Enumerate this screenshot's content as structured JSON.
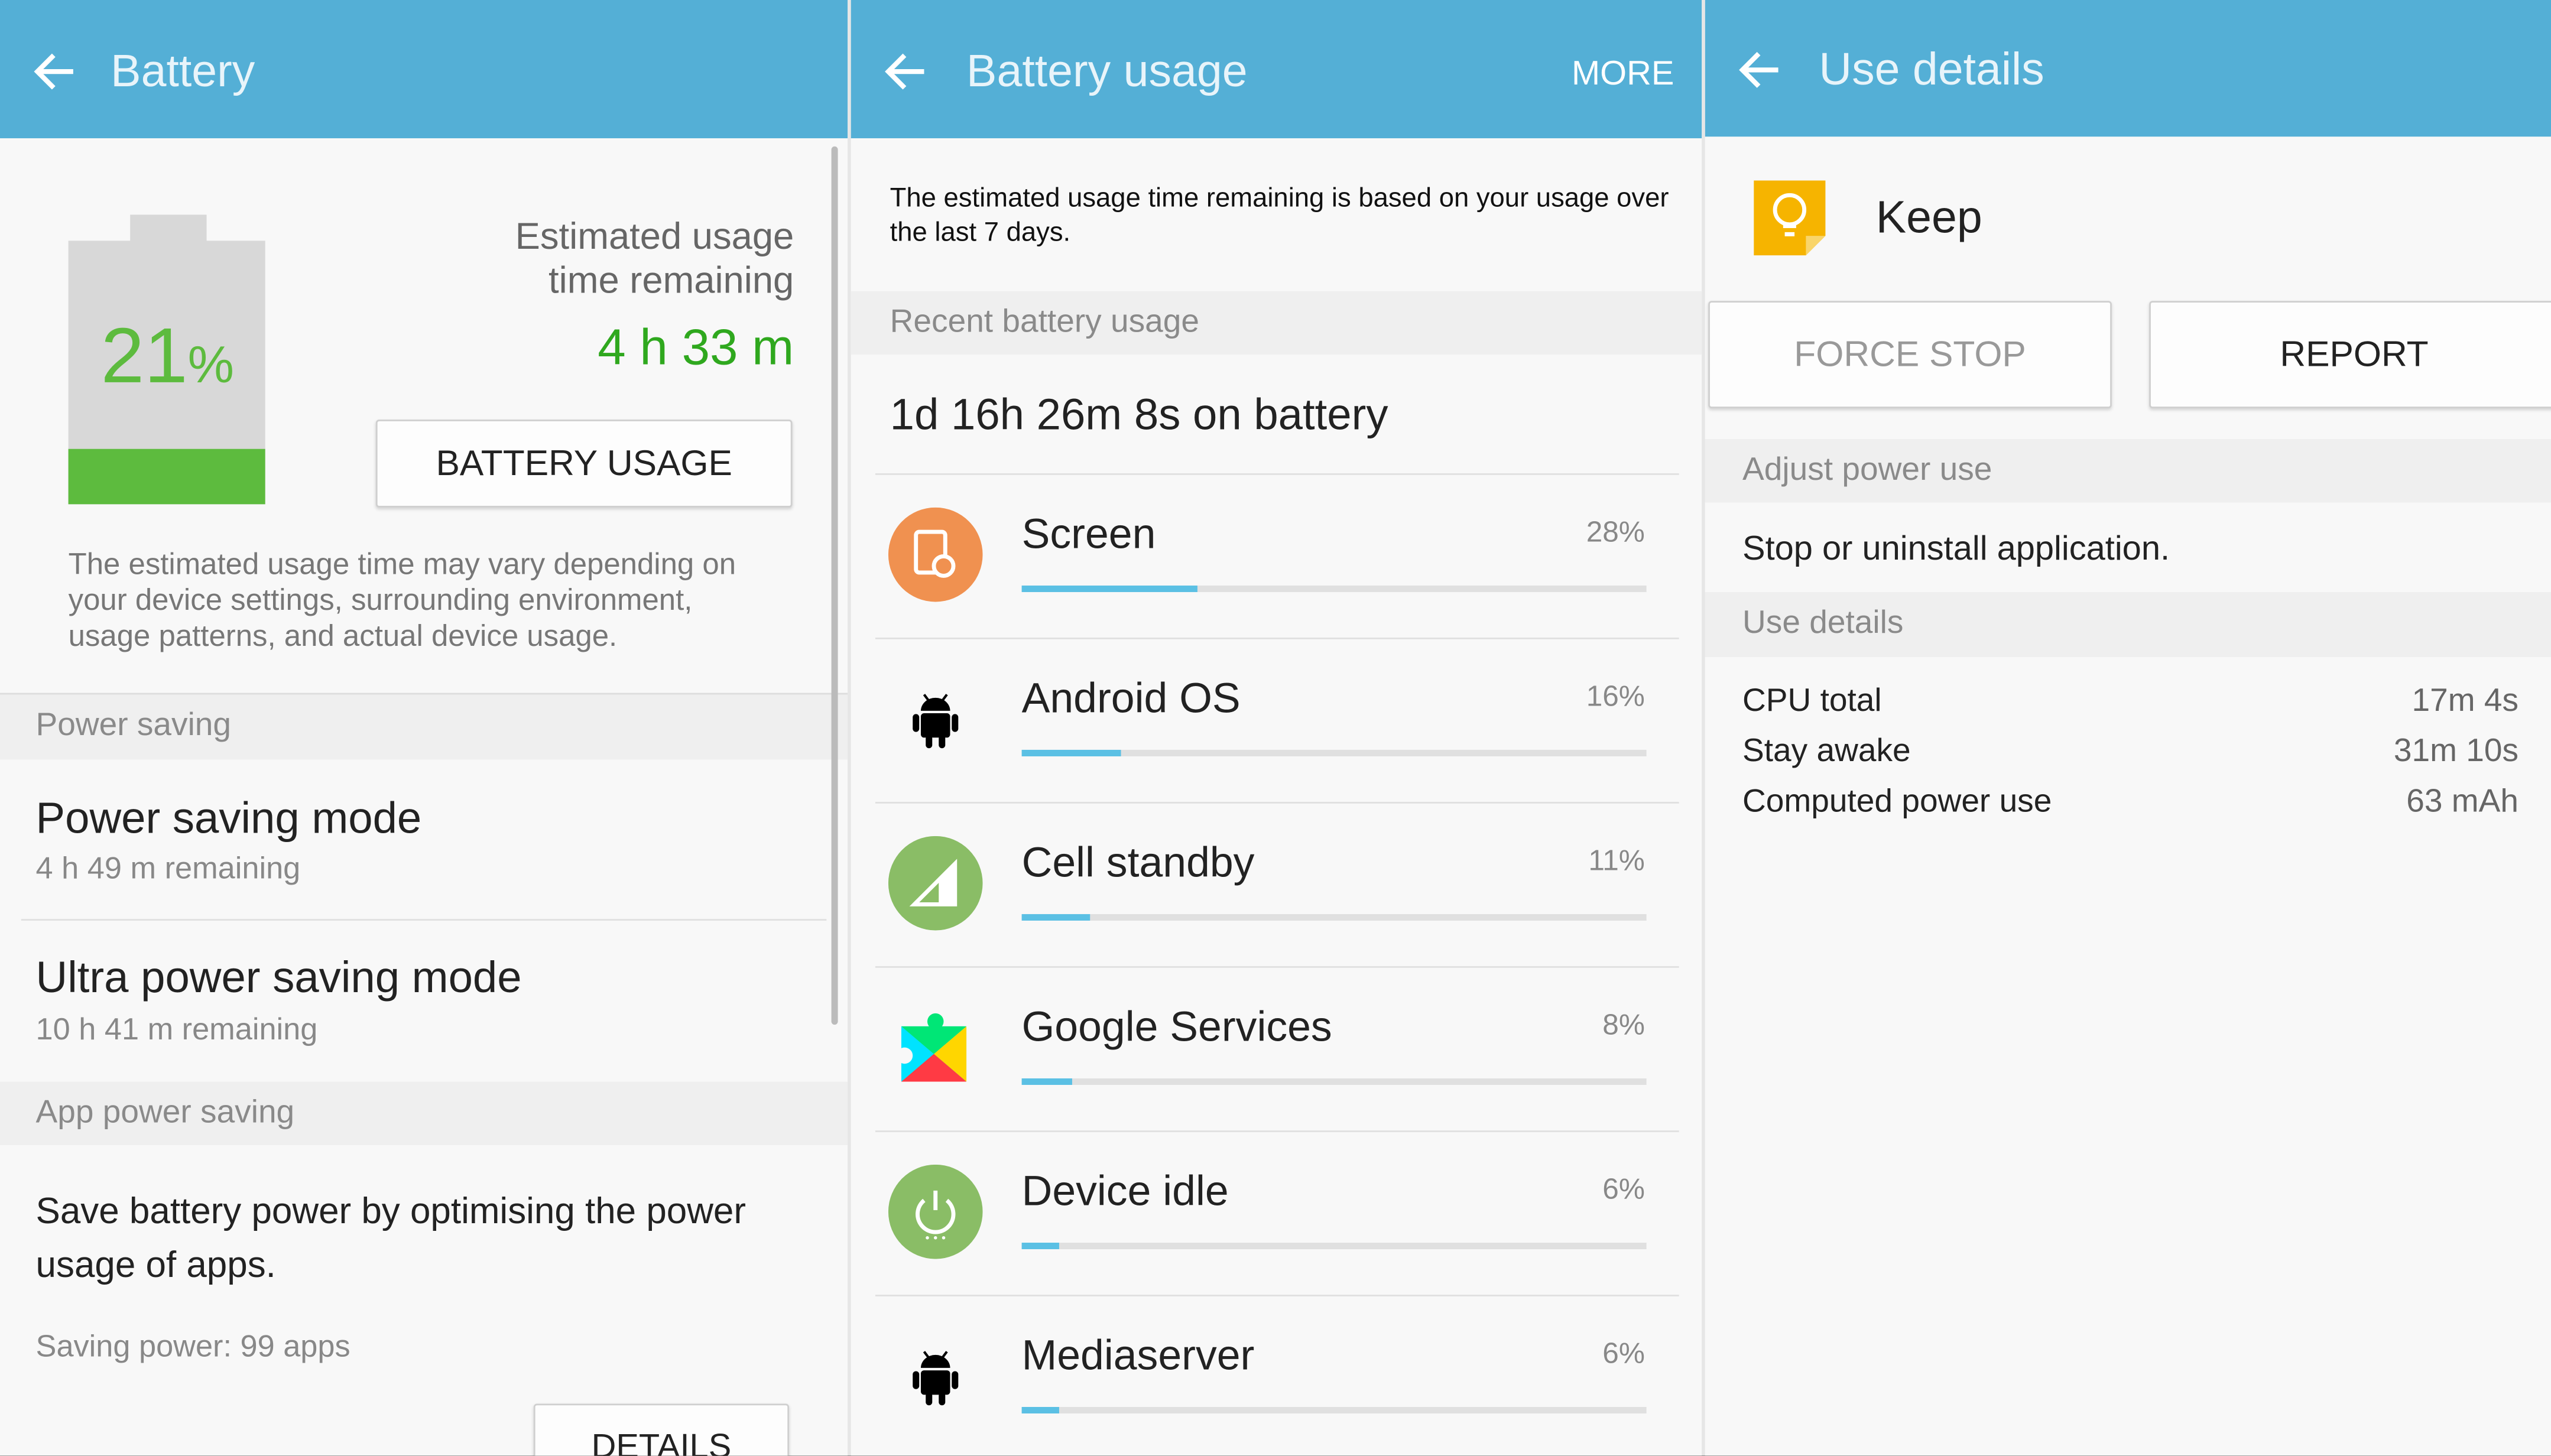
{
  "colors": {
    "header": "#54afd6",
    "accent_green": "#2fa81e",
    "battery_fill": "#5dbb3e",
    "usage_bar": "#5bc0e4"
  },
  "battery": {
    "title": "Battery",
    "back_icon": "arrow-left-icon",
    "level_percent": 21,
    "level_number": "21",
    "level_unit": "%",
    "estimate_label_1": "Estimated usage",
    "estimate_label_2": "time remaining",
    "estimate_value": "4 h 33 m",
    "battery_usage_button": "BATTERY USAGE",
    "disclaimer": "The estimated usage time may vary depending on your device settings, surrounding environment, usage patterns, and actual device usage.",
    "power_saving_header": "Power saving",
    "power_saving_mode": {
      "title": "Power saving mode",
      "subtitle": "4 h 49 m remaining"
    },
    "ultra_power_saving_mode": {
      "title": "Ultra power saving mode",
      "subtitle": "10 h 41 m remaining"
    },
    "app_power_saving_header": "App power saving",
    "app_power_saving_text": "Save battery power by optimising the power usage of apps.",
    "saving_power": "Saving power: 99 apps",
    "details_button": "DETAILS"
  },
  "usage": {
    "title": "Battery usage",
    "more": "MORE",
    "info": "The estimated usage time remaining is based on your usage over the last 7 days.",
    "recent_header": "Recent battery usage",
    "on_battery": "1d 16h 26m 8s on battery",
    "items": [
      {
        "name": "Screen",
        "percent": "28%",
        "value": 28,
        "icon": "screen-brightness-icon"
      },
      {
        "name": "Android OS",
        "percent": "16%",
        "value": 16,
        "icon": "android-icon"
      },
      {
        "name": "Cell standby",
        "percent": "11%",
        "value": 11,
        "icon": "cell-signal-icon"
      },
      {
        "name": "Google Services",
        "percent": "8%",
        "value": 8,
        "icon": "google-play-services-icon"
      },
      {
        "name": "Device idle",
        "percent": "6%",
        "value": 6,
        "icon": "power-icon"
      },
      {
        "name": "Mediaserver",
        "percent": "6%",
        "value": 6,
        "icon": "android-icon"
      }
    ]
  },
  "details": {
    "title": "Use details",
    "app_name": "Keep",
    "app_icon": "keep-lightbulb-icon",
    "force_stop": "FORCE STOP",
    "report": "REPORT",
    "adjust_header": "Adjust power use",
    "adjust_text": "Stop or uninstall application.",
    "use_details_header": "Use details",
    "rows": [
      {
        "label": "CPU total",
        "value": "17m 4s"
      },
      {
        "label": "Stay awake",
        "value": "31m 10s"
      },
      {
        "label": "Computed power use",
        "value": "63 mAh"
      }
    ]
  }
}
